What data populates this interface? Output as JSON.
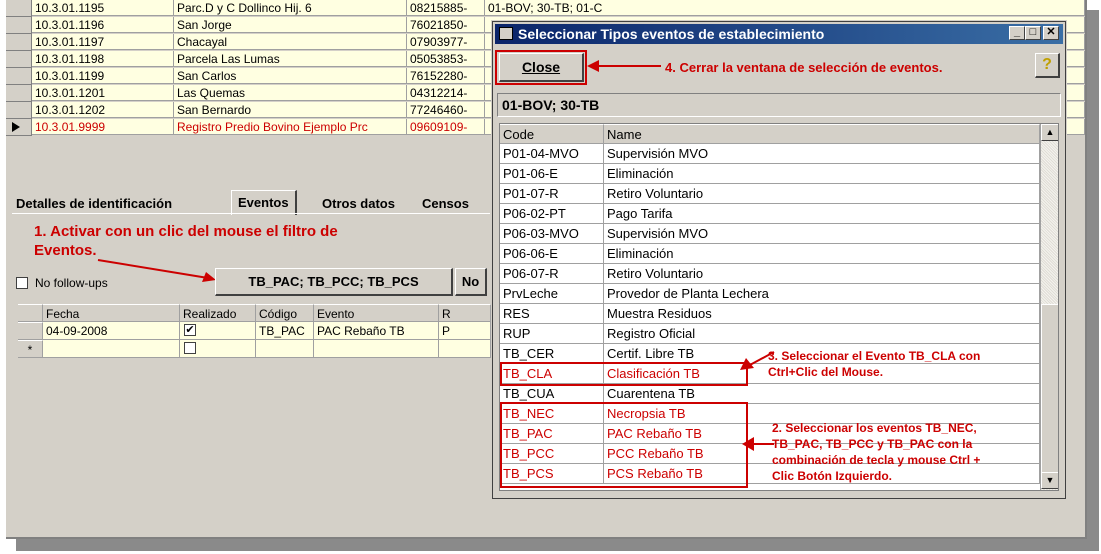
{
  "top_rows": [
    {
      "code": "10.3.01.1195",
      "name": "Parc.D y C Dollinco Hij. 6",
      "rut": "08215885-",
      "extra": "01-BOV; 30-TB; 01-C"
    },
    {
      "code": "10.3.01.1196",
      "name": "San Jorge",
      "rut": "76021850-"
    },
    {
      "code": "10.3.01.1197",
      "name": "Chacayal",
      "rut": "07903977-"
    },
    {
      "code": "10.3.01.1198",
      "name": "Parcela Las Lumas",
      "rut": "05053853-"
    },
    {
      "code": "10.3.01.1199",
      "name": "San Carlos",
      "rut": "76152280-"
    },
    {
      "code": "10.3.01.1201",
      "name": "Las Quemas",
      "rut": "04312214-"
    },
    {
      "code": "10.3.01.1202",
      "name": "San Bernardo",
      "rut": "77246460-"
    },
    {
      "code": "10.3.01.9999",
      "name": "Registro Predio Bovino Ejemplo Prc",
      "rut": "09609109-"
    }
  ],
  "tabs": {
    "detalles": "Detalles de identificación",
    "eventos": "Eventos",
    "otros": "Otros datos",
    "censos": "Censos"
  },
  "notes": {
    "n1_line1": "1. Activar con un clic del mouse el filtro de",
    "n1_line2": "Eventos.",
    "n2": [
      "2. Seleccionar los eventos TB_NEC,",
      "TB_PAC, TB_PCC y TB_PAC con la",
      "combinación de tecla y mouse Ctrl +",
      "Clic Botón Izquierdo."
    ],
    "n3": [
      "3. Seleccionar el Evento TB_CLA con",
      "Ctrl+Clic del Mouse."
    ],
    "n4": "4. Cerrar la ventana de selección de eventos."
  },
  "filters": {
    "no_follow_ups": "No follow-ups",
    "event_filter_button": "TB_PAC; TB_PCC; TB_PCS",
    "no_button": "No"
  },
  "lower_grid": {
    "headers": [
      "Fecha",
      "Realizado",
      "Código",
      "Evento",
      "R"
    ],
    "row": {
      "fecha": "04-09-2008",
      "codigo": "TB_PAC",
      "evento": "PAC Rebaño TB",
      "r": "P"
    },
    "new_row_marker": "*"
  },
  "dialog": {
    "title": "Seleccionar Tipos eventos de establecimiento",
    "close_label": "Close",
    "filter_label": "01-BOV; 30-TB",
    "help_icon": "?",
    "columns": {
      "code": "Code",
      "name": "Name"
    },
    "rows": [
      {
        "code": "P01-04-MVO",
        "name": "Supervisión MVO"
      },
      {
        "code": "P01-06-E",
        "name": "Eliminación"
      },
      {
        "code": "P01-07-R",
        "name": "Retiro Voluntario"
      },
      {
        "code": "P06-02-PT",
        "name": "Pago Tarifa"
      },
      {
        "code": "P06-03-MVO",
        "name": "Supervisión MVO"
      },
      {
        "code": "P06-06-E",
        "name": "Eliminación"
      },
      {
        "code": "P06-07-R",
        "name": "Retiro Voluntario"
      },
      {
        "code": "PrvLeche",
        "name": "Provedor de Planta Lechera"
      },
      {
        "code": "RES",
        "name": "Muestra Residuos"
      },
      {
        "code": "RUP",
        "name": "Registro Oficial"
      },
      {
        "code": "TB_CER",
        "name": "Certif. Libre TB"
      },
      {
        "code": "TB_CLA",
        "name": "Clasificación TB"
      },
      {
        "code": "TB_CUA",
        "name": "Cuarentena TB"
      },
      {
        "code": "TB_NEC",
        "name": "Necropsia TB"
      },
      {
        "code": "TB_PAC",
        "name": "PAC Rebaño TB"
      },
      {
        "code": "TB_PCC",
        "name": "PCC Rebaño TB"
      },
      {
        "code": "TB_PCS",
        "name": "PCS Rebaño TB"
      }
    ]
  },
  "icons": [
    "window-icon",
    "minimize-icon",
    "maximize-icon",
    "close-icon",
    "help-icon",
    "scroll-up-icon",
    "scroll-down-icon",
    "checkmark-icon",
    "row-pointer-icon"
  ],
  "colors": {
    "annotation": "#cc0000",
    "title_bar": "#0a246a",
    "grid_bg": "#ffffe1"
  }
}
